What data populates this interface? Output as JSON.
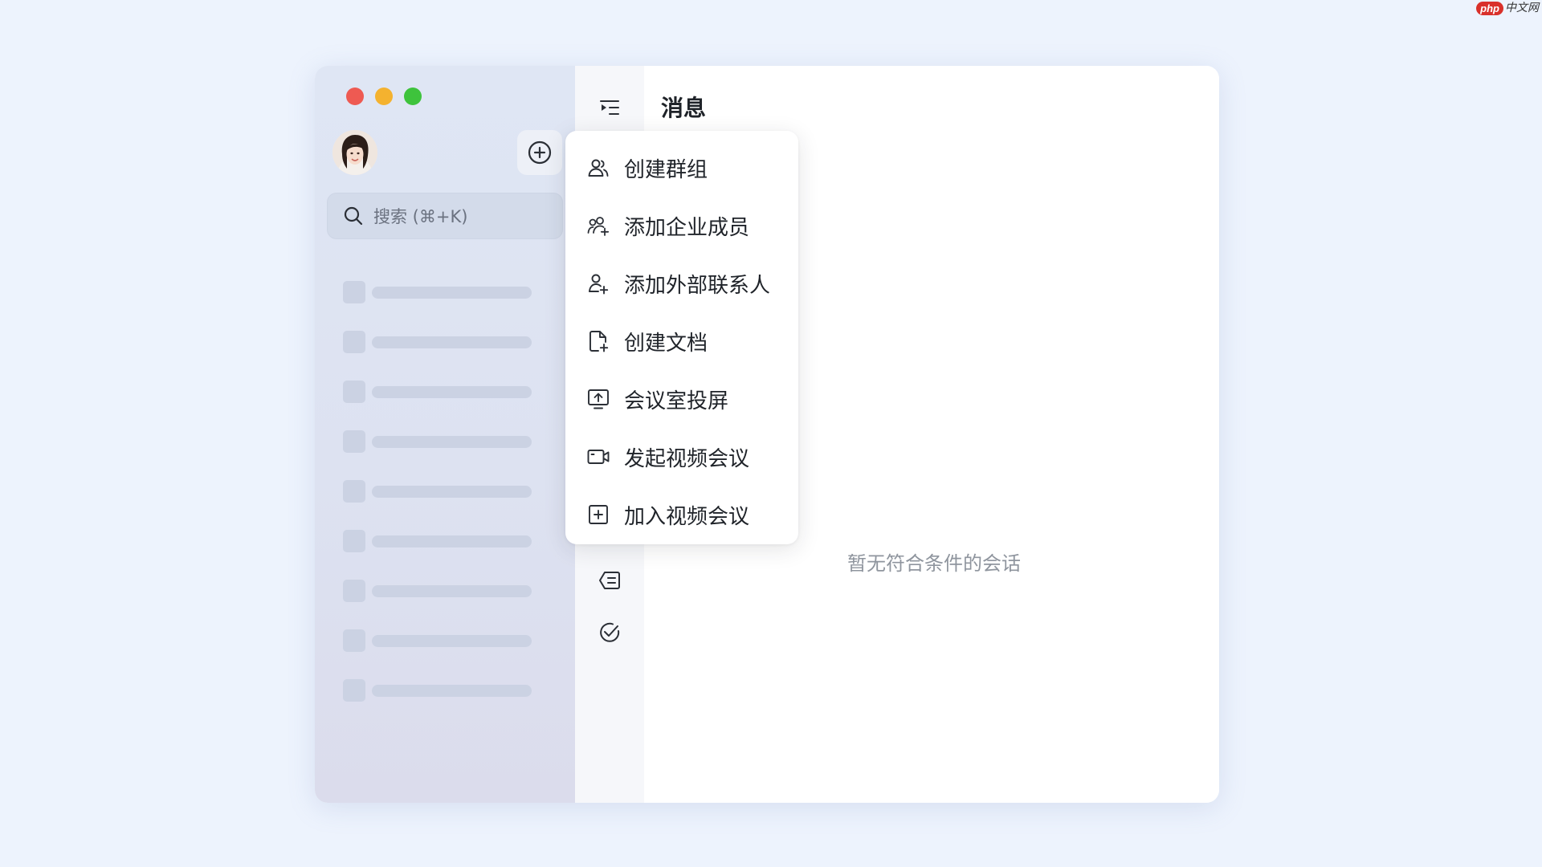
{
  "watermark": {
    "badge": "php",
    "site": "中文网"
  },
  "window": {
    "traffic_lights": {
      "close": "#ee5a52",
      "minimize": "#f4b22f",
      "zoom": "#3ec33c"
    }
  },
  "sidebar": {
    "avatar_icon": "user-avatar",
    "add_icon": "plus-circle-icon",
    "search": {
      "placeholder": "搜索 (⌘+K)"
    },
    "skeleton_rows": 9
  },
  "rail": {
    "icons": [
      "menu-expand-icon",
      "message-list-icon",
      "task-check-icon"
    ]
  },
  "main": {
    "title": "消息",
    "empty_text": "暂无符合条件的会话"
  },
  "menu": {
    "items": [
      {
        "label": "创建群组",
        "icon": "group-icon"
      },
      {
        "label": "添加企业成员",
        "icon": "add-members-icon"
      },
      {
        "label": "添加外部联系人",
        "icon": "add-contact-icon"
      },
      {
        "label": "创建文档",
        "icon": "new-document-icon"
      },
      {
        "label": "会议室投屏",
        "icon": "screen-cast-icon"
      },
      {
        "label": "发起视频会议",
        "icon": "video-camera-icon"
      },
      {
        "label": "加入视频会议",
        "icon": "join-meeting-icon"
      }
    ]
  }
}
